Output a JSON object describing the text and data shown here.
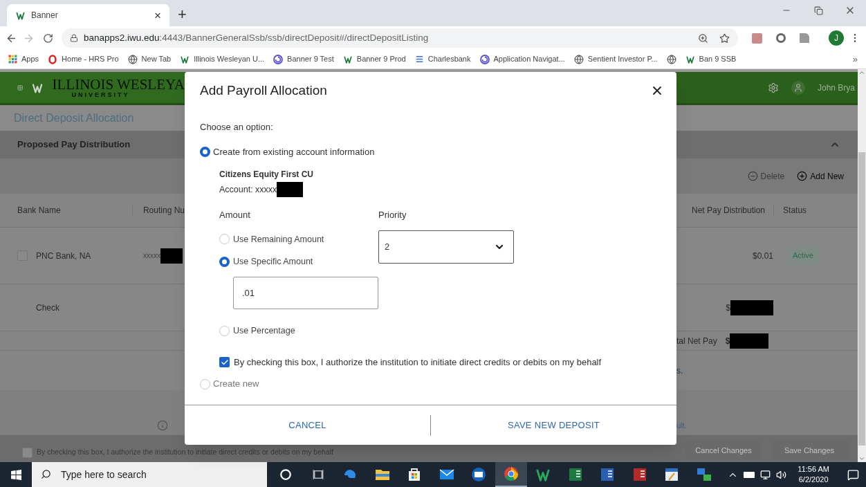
{
  "browser": {
    "tab": {
      "title": "Banner",
      "close": "×",
      "new_tab": "+"
    },
    "url": {
      "host": "banapps2.iwu.edu",
      "path": ":4443/BannerGeneralSsb/ssb/directDeposit#/directDepositListing"
    },
    "profile_initial": "J",
    "bookmarks": [
      {
        "label": "Apps",
        "kind": "apps"
      },
      {
        "label": "Home - HRS Pro",
        "kind": "ring"
      },
      {
        "label": "New Tab",
        "kind": "globe"
      },
      {
        "label": "Illinois Wesleyan U...",
        "kind": "logo"
      },
      {
        "label": "Banner 9 Test",
        "kind": "swirl"
      },
      {
        "label": "Banner 9 Prod",
        "kind": "logo"
      },
      {
        "label": "Charlesbank",
        "kind": "lines"
      },
      {
        "label": "Application Navigat...",
        "kind": "swirl"
      },
      {
        "label": "Sentient Investor P...",
        "kind": "globe"
      },
      {
        "kind": "globe"
      },
      {
        "label": "Ban 9 SSB",
        "kind": "logo"
      }
    ],
    "overflow": "»"
  },
  "header": {
    "logo_name": "ILLINOIS WESLEYA",
    "logo_sub": "UNIVERSITY",
    "user": "John Brya"
  },
  "page": {
    "title": "Direct Deposit Allocation",
    "section": "Proposed Pay Distribution",
    "actions": [
      {
        "label": "Delete",
        "disabled": true,
        "kind": "delete"
      },
      {
        "label": "Add New",
        "disabled": false,
        "kind": "add"
      }
    ],
    "columns": [
      "Bank Name",
      "Routing Nu",
      "Net Pay Distribution",
      "Status"
    ],
    "rows": [
      {
        "bank": "PNC Bank, NA",
        "checked": false,
        "routing": "xxxxx",
        "amount": "$0.01",
        "status": "Active"
      },
      {
        "bank": "Check",
        "amount": "$"
      }
    ],
    "total": {
      "label": "tal Net Pay",
      "amount": "$"
    },
    "note_link": "s.",
    "info_link": "ult.",
    "authorize": {
      "label": "By checking this box, I authorize the institution to initiate direct credits or debits on my behalf",
      "checked": false
    },
    "buttons": [
      "Cancel Changes",
      "Save Changes"
    ]
  },
  "modal": {
    "title": "Add Payroll Allocation",
    "prompt": "Choose an option:",
    "options": [
      {
        "label": "Create from existing account information",
        "selected": true
      },
      {
        "label": "Create new",
        "selected": false
      }
    ],
    "account": {
      "bank": "Citizens Equity First CU",
      "number": "Account: xxxxx"
    },
    "amount": {
      "label": "Amount",
      "options": [
        {
          "label": "Use Remaining Amount",
          "selected": false
        },
        {
          "label": "Use Specific Amount",
          "selected": true,
          "value": ".01"
        },
        {
          "label": "Use Percentage",
          "selected": false
        }
      ]
    },
    "priority": {
      "label": "Priority",
      "value": "2"
    },
    "authorize": {
      "label": "By checking this box, I authorize the institution to initiate direct credits or debits on my behalf",
      "checked": true
    },
    "buttons": [
      "CANCEL",
      "SAVE NEW DEPOSIT"
    ]
  },
  "taskbar": {
    "search_placeholder": "Type here to search",
    "apps": [
      {
        "kind": "cortana",
        "active": false
      },
      {
        "kind": "taskview",
        "active": false
      },
      {
        "kind": "edge",
        "active": false
      },
      {
        "kind": "explorer",
        "active": false
      },
      {
        "kind": "store",
        "active": false
      },
      {
        "kind": "mail",
        "active": false
      },
      {
        "kind": "outlook",
        "active": false
      },
      {
        "kind": "chrome",
        "active": true
      },
      {
        "kind": "iwu",
        "active": false
      },
      {
        "kind": "excel",
        "active": false
      },
      {
        "kind": "word",
        "active": false
      },
      {
        "kind": "access",
        "active": false
      },
      {
        "kind": "paint",
        "active": false
      },
      {
        "kind": "network",
        "active": false
      }
    ],
    "time": "11:56 AM",
    "date": "6/2/2020"
  }
}
